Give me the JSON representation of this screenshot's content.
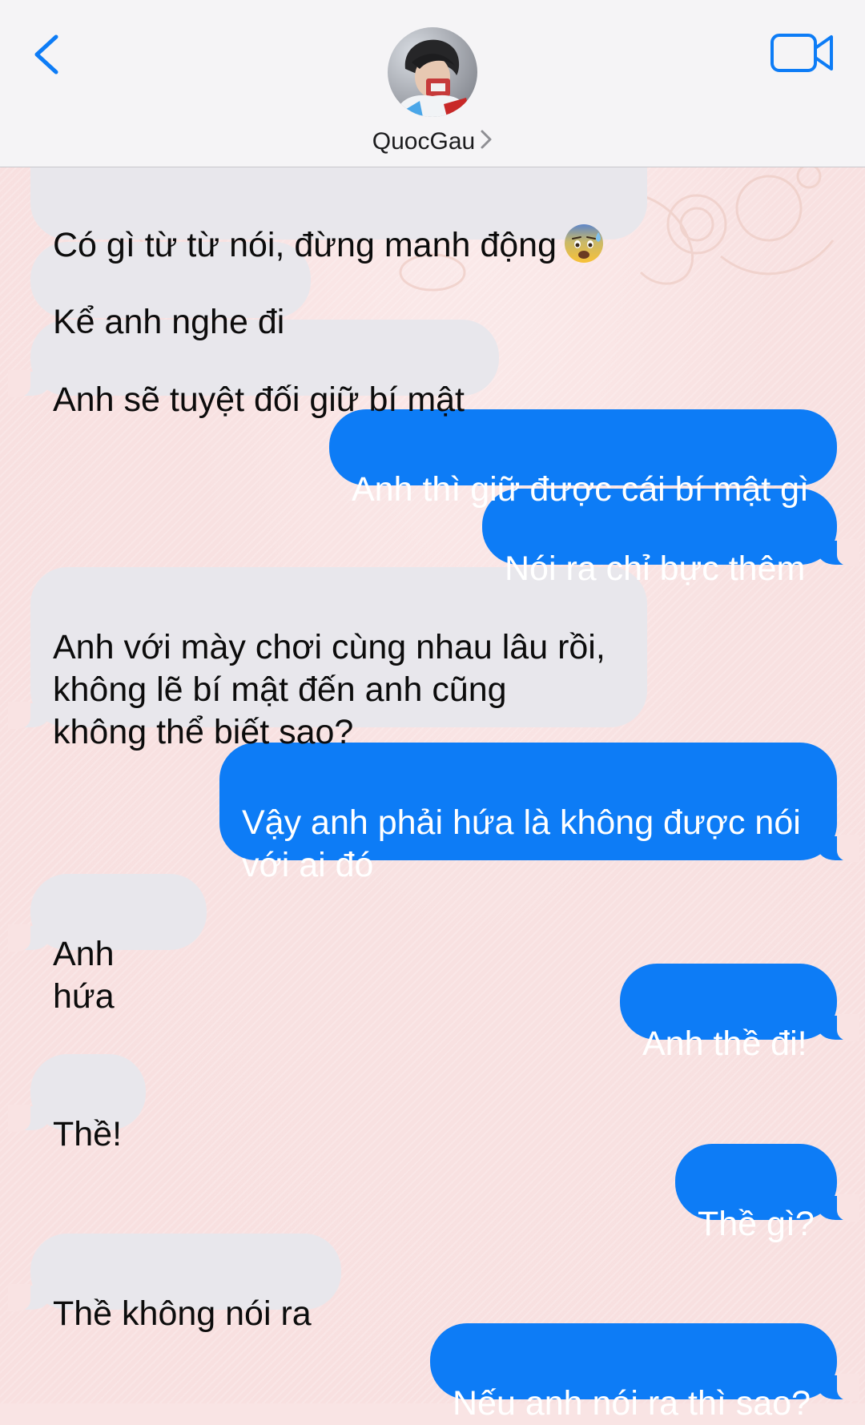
{
  "header": {
    "contact_name": "QuocGau",
    "back_icon": "chevron-left-icon",
    "video_icon": "video-camera-icon",
    "accent_color": "#0d7cf6"
  },
  "messages": [
    {
      "direction": "incoming",
      "text": "Có gì từ từ nói, đừng manh động",
      "emoji": "anxious-face-with-sweat-emoji"
    },
    {
      "direction": "incoming",
      "text": "Kể anh nghe đi"
    },
    {
      "direction": "incoming",
      "text": "Anh sẽ tuyệt đối giữ bí mật"
    },
    {
      "direction": "outgoing",
      "text": "Anh thì giữ được cái bí mật gì"
    },
    {
      "direction": "outgoing",
      "text": "Nói ra chỉ bực thêm"
    },
    {
      "direction": "incoming",
      "text": "Anh với mày chơi cùng nhau lâu rồi,\nkhông lẽ bí mật đến anh cũng\nkhông thể biết sao?"
    },
    {
      "direction": "outgoing",
      "text": "Vậy anh phải hứa là không được nói\nvới ai đó"
    },
    {
      "direction": "incoming",
      "text": "Anh hứa"
    },
    {
      "direction": "outgoing",
      "text": "Anh thề đi!"
    },
    {
      "direction": "incoming",
      "text": "Thề!"
    },
    {
      "direction": "outgoing",
      "text": "Thề gì?"
    },
    {
      "direction": "incoming",
      "text": "Thề không nói ra"
    },
    {
      "direction": "outgoing",
      "text": "Nếu anh nói ra thì sao?"
    }
  ]
}
